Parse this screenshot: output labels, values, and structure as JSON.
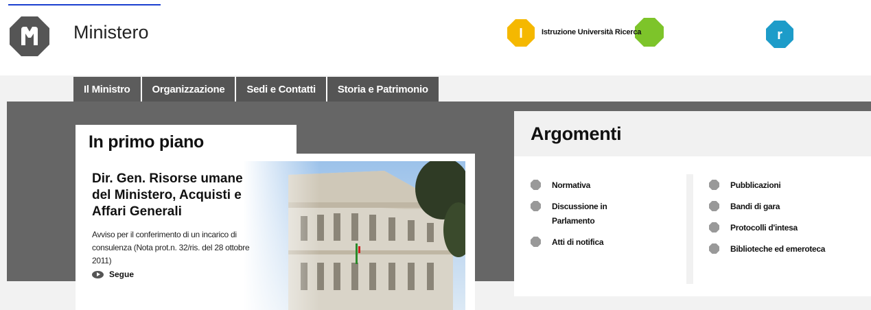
{
  "header": {
    "brand": "Ministero",
    "tricolor_label": "Istruzione Università Ricerca",
    "tri_letters": {
      "i": "I",
      "r": "r"
    },
    "colors": {
      "yellow": "#f5b800",
      "green": "#7dc42a",
      "blue": "#1d9cc9",
      "logo": "#555555"
    }
  },
  "nav": {
    "items": [
      {
        "label": "Il Ministro"
      },
      {
        "label": "Organizzazione"
      },
      {
        "label": "Sedi e Contatti"
      },
      {
        "label": "Storia e Patrimonio"
      }
    ]
  },
  "primo_piano": {
    "title": "In primo piano",
    "feature": {
      "title": "Dir. Gen. Risorse umane del Ministero, Acquisti e Affari Generali",
      "body": "Avviso per il conferimento di un incarico di consulenza (Nota prot.n. 32/ris. del 28 ottobre 2011)",
      "more": "Segue"
    }
  },
  "argomenti": {
    "title": "Argomenti",
    "left": [
      {
        "label": "Normativa"
      },
      {
        "label": "Discussione in Parlamento"
      },
      {
        "label": "Atti di notifica"
      }
    ],
    "right": [
      {
        "label": "Pubblicazioni"
      },
      {
        "label": "Bandi di gara"
      },
      {
        "label": "Protocolli d'intesa"
      },
      {
        "label": "Biblioteche ed emeroteca"
      }
    ]
  },
  "icons": {
    "logo": "ministero-logo-icon",
    "bullet": "octagon-bullet-icon",
    "more": "arrow-right-icon"
  }
}
